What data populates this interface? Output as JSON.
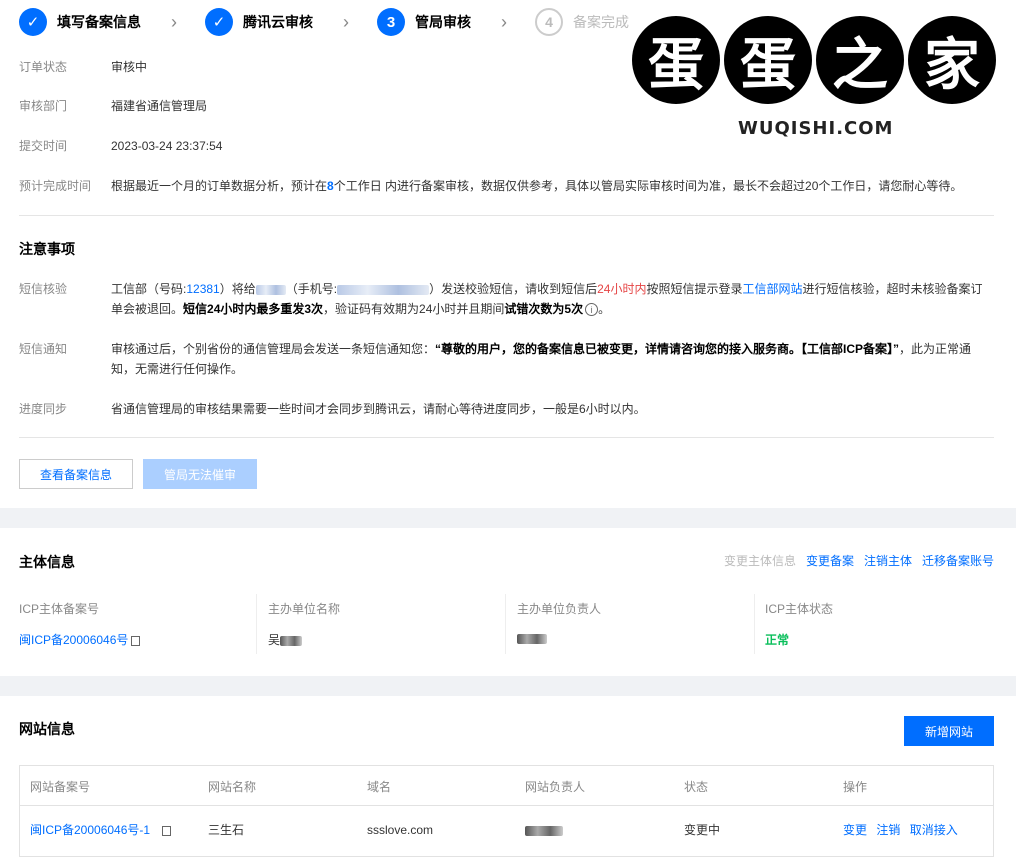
{
  "steps": [
    {
      "label": "填写备案信息",
      "status": "done"
    },
    {
      "label": "腾讯云审核",
      "status": "done"
    },
    {
      "label": "管局审核",
      "status": "active",
      "number": "3"
    },
    {
      "label": "备案完成",
      "status": "pending",
      "number": "4"
    }
  ],
  "watermark": {
    "chars": [
      "蛋",
      "蛋",
      "之",
      "家"
    ],
    "text": "WUQISHI.COM"
  },
  "order": {
    "status_label": "订单状态",
    "status_value": "审核中",
    "dept_label": "审核部门",
    "dept_value": "福建省通信管理局",
    "submit_label": "提交时间",
    "submit_value": "2023-03-24 23:37:54",
    "eta_label": "预计完成时间",
    "eta_pre": "根据最近一个月的订单数据分析，预计在",
    "eta_days": "8",
    "eta_post": "个工作日 内进行备案审核，数据仅供参考，具体以管局实际审核时间为准，最长不会超过20个工作日，请您耐心等待。"
  },
  "notice": {
    "title": "注意事项",
    "sms_verify_label": "短信核验",
    "sms_verify_p1": "工信部（号码:",
    "sms_verify_num": "12381",
    "sms_verify_p2": "）将给",
    "sms_verify_p3": "（手机号:",
    "sms_verify_p4": "）发送校验短信，请收到短信后",
    "sms_verify_red": "24小时内",
    "sms_verify_p5": "按照短信提示登录",
    "sms_verify_link": "工信部网站",
    "sms_verify_p6": "进行短信核验，超时未核验备案订单会被退回。",
    "sms_verify_b1": "短信24小时内最多重发3次",
    "sms_verify_p7": "，验证码有效期为24小时并且期间",
    "sms_verify_b2": "试错次数为5次",
    "sms_notify_label": "短信通知",
    "sms_notify_p1": "审核通过后，个别省份的通信管理局会发送一条短信通知您：",
    "sms_notify_b": "“尊敬的用户，您的备案信息已被变更，详情请咨询您的接入服务商。【工信部ICP备案】”",
    "sms_notify_p2": "，此为正常通知，无需进行任何操作。",
    "sync_label": "进度同步",
    "sync_value": "省通信管理局的审核结果需要一些时间才会同步到腾讯云，请耐心等待进度同步，一般是6小时以内。"
  },
  "buttons": {
    "view": "查看备案信息",
    "urge": "管局无法催审"
  },
  "main": {
    "title": "主体信息",
    "links": [
      "变更主体信息",
      "变更备案",
      "注销主体",
      "迁移备案账号"
    ],
    "cols": [
      {
        "header": "ICP主体备案号",
        "value": "闽ICP备20006046号"
      },
      {
        "header": "主办单位名称",
        "value": "吴"
      },
      {
        "header": "主办单位负责人",
        "value": ""
      },
      {
        "header": "ICP主体状态",
        "value": "正常"
      }
    ]
  },
  "site": {
    "title": "网站信息",
    "add_button": "新增网站",
    "headers": [
      "网站备案号",
      "网站名称",
      "域名",
      "网站负责人",
      "状态",
      "操作"
    ],
    "row": {
      "icp": "闽ICP备20006046号-1",
      "name": "三生石",
      "domain": "ssslove.com",
      "owner": "",
      "status": "变更中",
      "actions": [
        "变更",
        "注销",
        "取消接入"
      ]
    }
  },
  "colors": {
    "primary": "#006eff",
    "danger": "#e54545",
    "success": "#0abf5b"
  }
}
